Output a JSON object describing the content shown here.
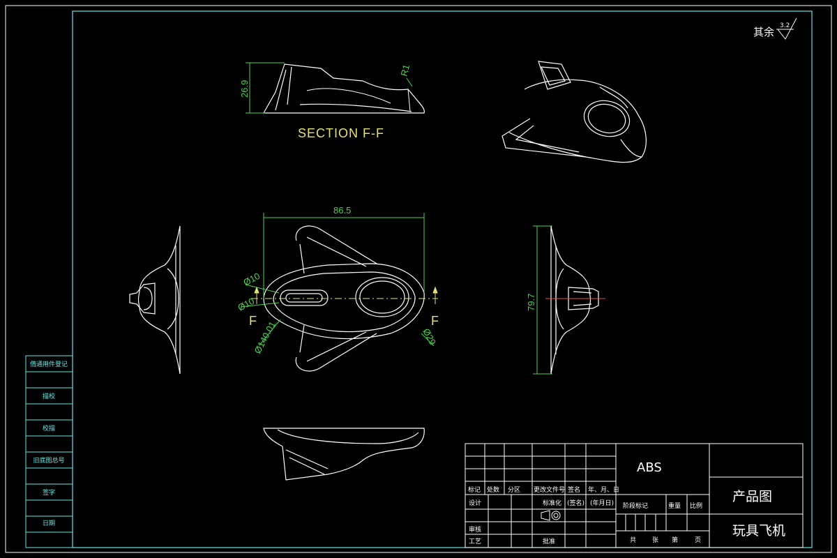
{
  "roughness": {
    "label": "其余",
    "value": "3.2"
  },
  "section": {
    "label": "SECTION F-F",
    "cut_left": "F",
    "cut_right": "F"
  },
  "dimensions": {
    "height_section": "26.9",
    "radius_section": "R1",
    "width_top": "86.5",
    "dia_a": "Ø10",
    "dia_b": "Ø10",
    "dia_c": "Ø140.01",
    "dia_d": "Ø29",
    "height_side": "79.7"
  },
  "side_strip": {
    "labels": [
      "借通用件登记",
      "旧底图总号",
      "描校",
      "校描",
      "签字",
      "日期"
    ]
  },
  "title_block": {
    "material": "ABS",
    "drawing_type": "产品图",
    "part_name": "玩具飞机",
    "header_row": [
      "标记",
      "处数",
      "分区",
      "更改文件号",
      "签名",
      "年、月、日"
    ],
    "row_design": [
      "设计",
      "标准化",
      "(签名)",
      "(年月日)"
    ],
    "row_review": "审核",
    "row_process": "工艺",
    "row_approve": "批准",
    "stage_headers": [
      "阶段标记",
      "重量",
      "比例"
    ],
    "sheet_footer": [
      "共",
      "张",
      "第",
      "页"
    ]
  },
  "colors": {
    "background": "#000000",
    "frame": "#63e6e6",
    "geometry": "#ffffff",
    "dimension": "#4cd34c",
    "section_text": "#e8e07a",
    "centerline": "#e05050"
  }
}
